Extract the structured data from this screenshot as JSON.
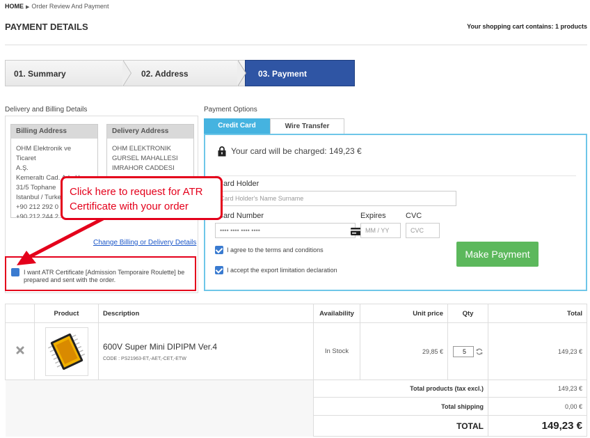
{
  "breadcrumb": {
    "home": "HOME",
    "current": "Order Review And Payment"
  },
  "page_title": "PAYMENT DETAILS",
  "cart_info": "Your shopping cart contains: 1 products",
  "steps": [
    {
      "label": "01. Summary"
    },
    {
      "label": "02. Address"
    },
    {
      "label": "03. Payment"
    }
  ],
  "delivery": {
    "section_title": "Delivery and Billing Details",
    "billing": {
      "title": "Billing Address",
      "lines": "OHM Elektronik ve Ticaret\nA.Ş.\nKemeraltı Cad. Ada Han\n31/5 Tophane\nIstanbul / Turkey\n+90 212 292 0\n+90 212 244 2"
    },
    "shipping": {
      "title": "Delivery Address",
      "lines": "OHM ELEKTRONIK\nGURSEL MAHALLESI\nIMRAHOR CADDESI"
    },
    "change_link": "Change Billing or Delivery Details",
    "atr_label": "I want ATR Certificate [Admission Temporaire Roulette] be prepared and sent with the order."
  },
  "callout": "Click here to request for ATR Certificate with your order",
  "payment": {
    "section_title": "Payment Options",
    "tabs": [
      "Credit Card",
      "Wire Transfer"
    ],
    "charge_text": "Your card will be charged: 149,23 €",
    "card_holder_label": "Card Holder",
    "card_holder_placeholder": "Card Holder's Name Surname",
    "card_number_label": "Card Number",
    "card_number_placeholder": "•••• •••• •••• ••••",
    "expires_label": "Expires",
    "expires_placeholder": "MM / YY",
    "cvc_label": "CVC",
    "cvc_placeholder": "CVC",
    "terms_label": "I agree to the terms and conditions",
    "export_label": "I accept the export limitation declaration",
    "pay_button": "Make Payment"
  },
  "table": {
    "headers": [
      "Product",
      "Description",
      "Availability",
      "Unit price",
      "Qty",
      "Total"
    ],
    "rows": [
      {
        "name": "600V Super Mini DIPIPM Ver.4",
        "code": "CODE : PS21963-ET,-AET,-CET,-ETW",
        "availability": "In Stock",
        "unit_price": "29,85 €",
        "qty": "5",
        "total": "149,23 €"
      }
    ],
    "summary": {
      "products_label": "Total products (tax excl.)",
      "products_value": "149,23 €",
      "shipping_label": "Total shipping",
      "shipping_value": "0,00 €",
      "total_label": "TOTAL",
      "total_value": "149,23 €"
    }
  },
  "colors": {
    "accent_blue": "#2f55a4",
    "tab_blue": "#45b3e0",
    "callout_red": "#e4001b",
    "pay_green": "#5cb85c"
  }
}
